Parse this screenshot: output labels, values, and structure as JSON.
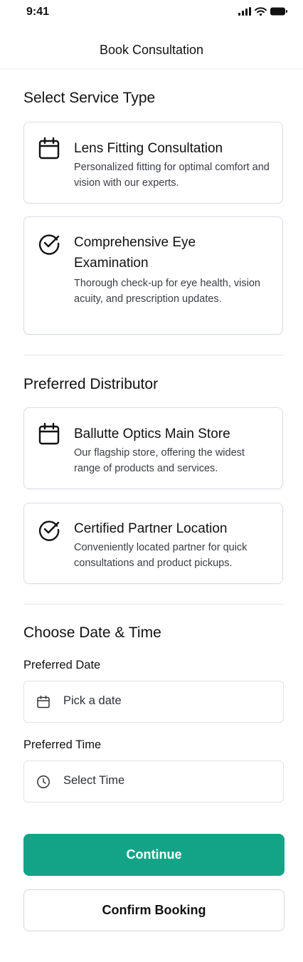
{
  "status_bar": {
    "time": "9:41"
  },
  "header": {
    "title": "Book Consultation"
  },
  "service_section": {
    "title": "Select Service Type",
    "options": [
      {
        "icon": "calendar-icon",
        "title": "Lens Fitting Consultation",
        "description": "Personalized fitting for optimal comfort and vision with our experts."
      },
      {
        "icon": "check-circle-icon",
        "title": "Comprehensive Eye Examination",
        "description": "Thorough check-up for eye health, vision acuity, and prescription updates."
      }
    ]
  },
  "distributor_section": {
    "title": "Preferred Distributor",
    "options": [
      {
        "icon": "calendar-icon",
        "title": "Ballutte Optics Main Store",
        "description": "Our flagship store, offering the widest range of products and services."
      },
      {
        "icon": "check-circle-icon",
        "title": "Certified Partner Location",
        "description": "Conveniently located partner for quick consultations and product pickups."
      }
    ]
  },
  "datetime_section": {
    "title": "Choose Date & Time",
    "date_label": "Preferred Date",
    "date_placeholder": "Pick a date",
    "time_label": "Preferred Time",
    "time_placeholder": "Select Time"
  },
  "actions": {
    "continue_label": "Continue",
    "confirm_label": "Confirm Booking"
  },
  "colors": {
    "primary": "#13a487",
    "border": "#d9dde3"
  }
}
